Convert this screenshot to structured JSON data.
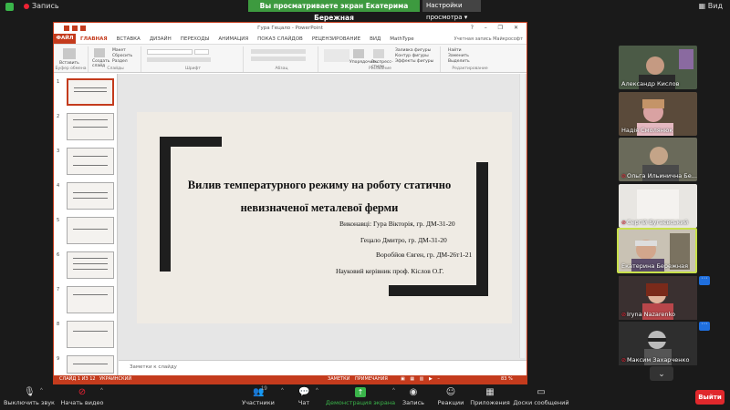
{
  "topbar": {
    "recording_label": "Запись",
    "share_banner": "Вы просматриваете экран Екатерима Бережная",
    "view_options": "Настройки просмотра",
    "view_button": "Вид"
  },
  "ppt": {
    "window_title": "Гура Гецало - PowerPoint",
    "window_controls": "? – ❐ ✕",
    "tabs": [
      "ФАЙЛ",
      "ГЛАВНАЯ",
      "ВСТАВКА",
      "ДИЗАЙН",
      "ПЕРЕХОДЫ",
      "АНИМАЦИЯ",
      "ПОКАЗ СЛАЙДОВ",
      "РЕЦЕНЗИРОВАНИЕ",
      "ВИД",
      "MathType"
    ],
    "active_tab": "ГЛАВНАЯ",
    "account": "Учетная запись Майкрософт",
    "ribbon": {
      "paste": "Вставить",
      "create_slide": "Создать слайд",
      "layout": "Макет",
      "reset": "Сбросить",
      "section": "Раздел",
      "arrange": "Упорядочить",
      "quick_styles": "Экспресс-стили",
      "fill": "Заливка фигуры",
      "outline": "Контур фигуры",
      "effects": "Эффекты фигуры",
      "find": "Найти",
      "replace": "Заменить",
      "select": "Выделить",
      "groups": [
        "Буфер обмена",
        "Слайды",
        "Шрифт",
        "Абзац",
        "Рисование",
        "Редактирование"
      ]
    },
    "thumbnails": [
      "1",
      "2",
      "3",
      "4",
      "5",
      "6",
      "7",
      "8",
      "9"
    ],
    "slide": {
      "title_line1": "Вилив температурного режиму на роботу статично",
      "title_line2": "невизначеної металевої ферми",
      "performers": "Виконавці: Гура Вікторія, гр. ДМ-31-20",
      "performer2": "Гецало Дмитро, гр. ДМ-31-20",
      "performer3": "Воробйов Євген, гр. ДМ-26т1-21",
      "supervisor": "Науковий керівник проф. Кіслов О.Г."
    },
    "notes_placeholder": "Заметки к слайду",
    "status": {
      "slide_count": "СЛАЙД 1 ИЗ 12",
      "language": "УКРАИНСКИЙ",
      "notes": "ЗАМЕТКИ",
      "comments": "ПРИМЕЧАНИЯ",
      "zoom": "83 %"
    }
  },
  "participants": [
    {
      "name": "Александр Кислов",
      "muted": false
    },
    {
      "name": "Надія Смолянюк",
      "muted": false
    },
    {
      "name": "Ольга Ильинична Бе...",
      "muted": true
    },
    {
      "name": "Сергій Бугаєвський",
      "muted": true
    },
    {
      "name": "Екатерина Бережная",
      "muted": false
    },
    {
      "name": "Iryna Nazarenko",
      "muted": true
    },
    {
      "name": "Максим Захарченко",
      "muted": true
    }
  ],
  "toolbar": {
    "mute": "Выключить звук",
    "video": "Начать видео",
    "participants": "Участники",
    "participants_count": "19",
    "chat": "Чат",
    "share": "Демонстрация экрана",
    "record": "Запись",
    "reactions": "Реакции",
    "apps": "Приложения",
    "whiteboards": "Доски сообщений",
    "leave": "Выйти"
  },
  "colors": {
    "ppt_accent": "#c43b1d",
    "zoom_green": "#3ab54a",
    "leave_red": "#e0282c",
    "active_speaker": "#c8e04a"
  }
}
